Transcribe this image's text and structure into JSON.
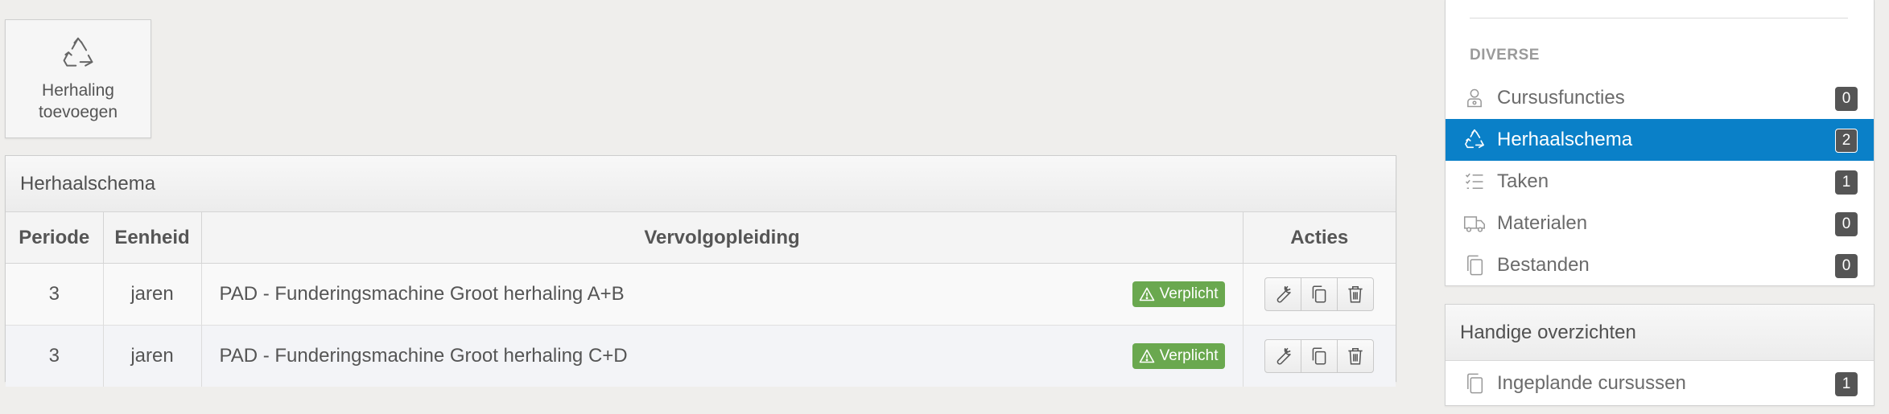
{
  "toolbar": {
    "add_repeat_label": "Herhaling toevoegen",
    "add_repeat_icon": "recycle-icon"
  },
  "schedule": {
    "title": "Herhaalschema",
    "columns": [
      "Periode",
      "Eenheid",
      "Vervolgopleiding",
      "Acties"
    ],
    "rows": [
      {
        "period": "3",
        "unit": "jaren",
        "course": "PAD - Funderingsmachine Groot herhaling A+B",
        "badge": "Verplicht"
      },
      {
        "period": "3",
        "unit": "jaren",
        "course": "PAD - Funderingsmachine Groot herhaling C+D",
        "badge": "Verplicht"
      }
    ]
  },
  "sidebar": {
    "category": "DIVERSE",
    "items": [
      {
        "label": "Cursusfuncties",
        "count": "0",
        "icon": "user-badge-icon"
      },
      {
        "label": "Herhaalschema",
        "count": "2",
        "icon": "recycle-icon",
        "active": true
      },
      {
        "label": "Taken",
        "count": "1",
        "icon": "tasks-icon"
      },
      {
        "label": "Materialen",
        "count": "0",
        "icon": "truck-icon"
      },
      {
        "label": "Bestanden",
        "count": "0",
        "icon": "files-icon"
      }
    ]
  },
  "overviews": {
    "title": "Handige overzichten",
    "items": [
      {
        "label": "Ingeplande cursussen",
        "count": "1",
        "icon": "files-icon"
      }
    ]
  },
  "colors": {
    "active": "#0a80c8",
    "badge_green": "#6aa84f",
    "count_bg": "#555555"
  }
}
